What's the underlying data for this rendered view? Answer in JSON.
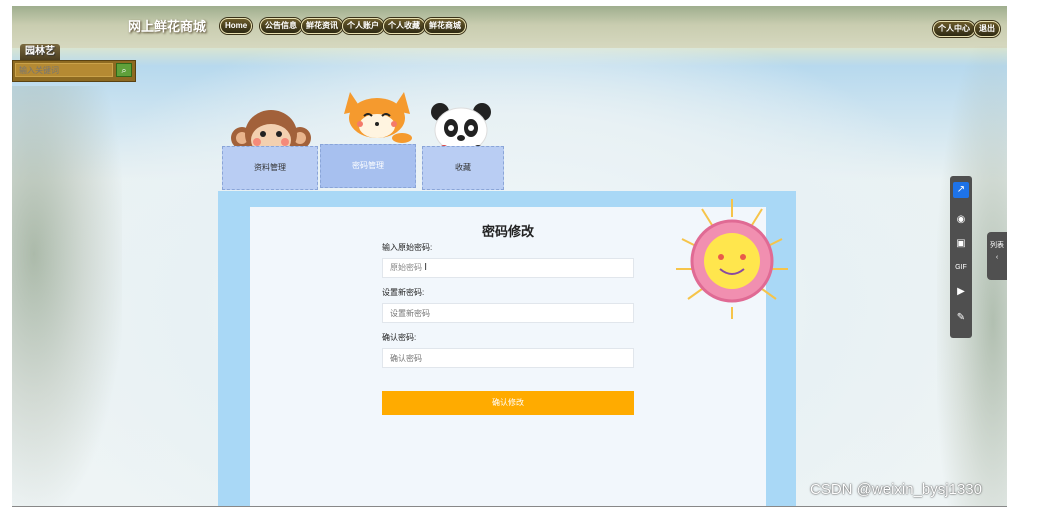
{
  "header": {
    "site_title": "网上鲜花商城",
    "nav": [
      "Home",
      "公告信息",
      "鲜花资讯",
      "个人账户",
      "个人收藏",
      "鲜花商城"
    ],
    "right_buttons": [
      "个人中心",
      "退出"
    ]
  },
  "search": {
    "label": "园林艺",
    "placeholder": "输入关键词",
    "button_icon": "search-icon"
  },
  "tabs": [
    {
      "label": "资料管理",
      "icon": "monkey-icon"
    },
    {
      "label": "密码管理",
      "icon": "fox-icon",
      "active": true
    },
    {
      "label": "收藏",
      "icon": "panda-icon"
    }
  ],
  "form": {
    "title": "密码修改",
    "old_label": "输入原始密码:",
    "old_value": "原始密码",
    "new_label": "设置新密码:",
    "new_placeholder": "设置新密码",
    "confirm_label": "确认密码:",
    "confirm_placeholder": "确认密码",
    "submit_label": "确认修改"
  },
  "toolbar": {
    "items": [
      "share-icon",
      "camera-icon",
      "screenshot-icon",
      "gif-icon",
      "record-icon",
      "pen-icon"
    ],
    "side_tab_label": "列表"
  },
  "watermark": "CSDN @weixin_bysj1330",
  "colors": {
    "accent": "#ffab00",
    "tab_bg": "#b9cdf3",
    "panel_border": "#a9d8f6",
    "toolbar_active": "#1e73e8"
  }
}
